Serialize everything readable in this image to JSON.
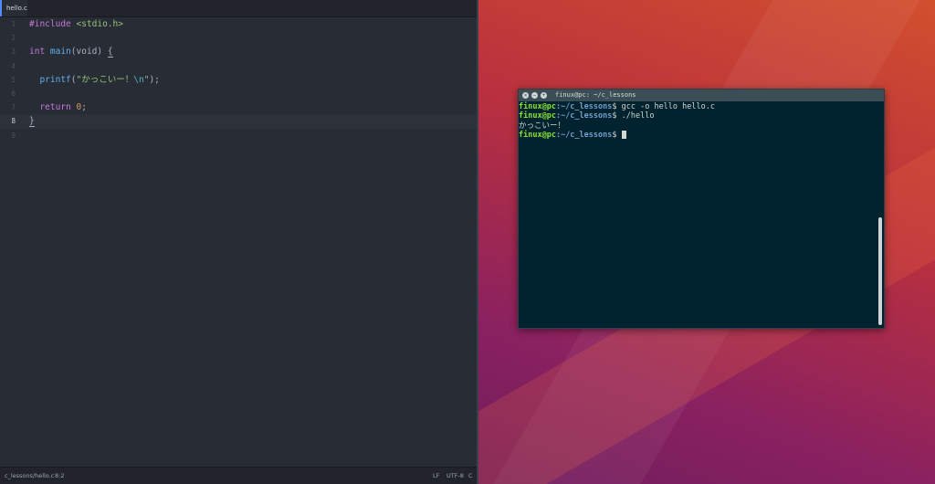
{
  "editor": {
    "tab_label": "hello.c",
    "lines": [
      {
        "num": "1"
      },
      {
        "num": "2"
      },
      {
        "num": "3"
      },
      {
        "num": "4"
      },
      {
        "num": "5"
      },
      {
        "num": "6"
      },
      {
        "num": "7"
      },
      {
        "num": "8"
      },
      {
        "num": "9"
      }
    ],
    "code": {
      "include_kw": "#include",
      "include_hdr": " <stdio.h>",
      "type_int": "int",
      "fn_main": " main",
      "main_args": "(void) ",
      "open_brace": "{",
      "fn_printf": "printf",
      "paren_open": "(",
      "str_text": "\"かっこいー！",
      "str_esc": "\\n",
      "str_close": "\"",
      "paren_close": ");",
      "return_kw": "return",
      "return_val": "0",
      "semicolon": ";",
      "close_brace": "}"
    },
    "status": {
      "file_path": "c_lessons/hello.c",
      "cursor_pos": "8:2",
      "line_ending": "LF",
      "encoding": "UTF-8",
      "grammar": "C"
    }
  },
  "terminal": {
    "title": "finux@pc: ~/c_lessons",
    "prompt_user": "finux@pc",
    "prompt_path": ":~/c_lessons",
    "prompt_symbol": "$ ",
    "command1": "gcc -o hello hello.c",
    "command2": "./hello",
    "output1": "かっこいー！"
  }
}
